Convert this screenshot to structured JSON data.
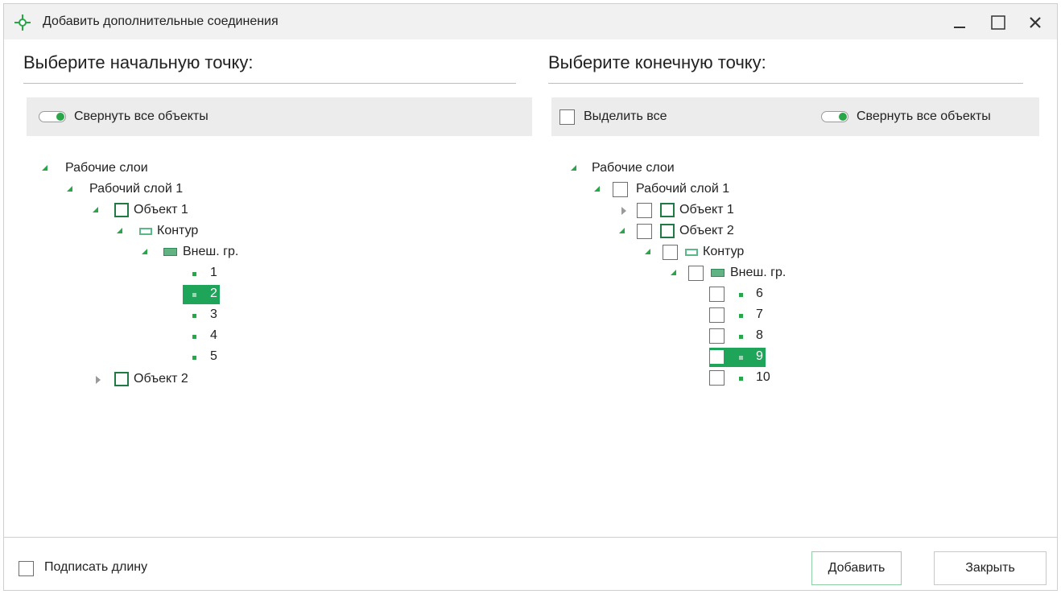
{
  "window": {
    "title": "Добавить дополнительные соединения",
    "accent_color": "#2aa64a",
    "selection_color": "#1fa55a"
  },
  "left_panel": {
    "title": "Выберите начальную точку:",
    "collapse_label": "Свернуть все объекты",
    "collapse_on": true,
    "tree": {
      "root": "Рабочие слои",
      "layer": "Рабочий слой 1",
      "object1": "Объект 1",
      "contour": "Контур",
      "outer": "Внеш. гр.",
      "points": [
        "1",
        "2",
        "3",
        "4",
        "5"
      ],
      "selected_point": "2",
      "object2": "Объект 2"
    }
  },
  "right_panel": {
    "title": "Выберите конечную точку:",
    "select_all_label": "Выделить все",
    "collapse_label": "Свернуть все объекты",
    "collapse_on": true,
    "tree": {
      "root": "Рабочие слои",
      "layer": "Рабочий слой 1",
      "object1": "Объект 1",
      "object2": "Объект 2",
      "contour": "Контур",
      "outer": "Внеш. гр.",
      "points": [
        "6",
        "7",
        "8",
        "9",
        "10"
      ],
      "selected_point": "9"
    }
  },
  "footer": {
    "sign_length_label": "Подписать длину",
    "add_label": "Добавить",
    "close_label": "Закрыть"
  },
  "icons": {
    "title": "target-icon",
    "minimize": "minimize-icon",
    "maximize": "maximize-icon",
    "close": "close-icon"
  }
}
